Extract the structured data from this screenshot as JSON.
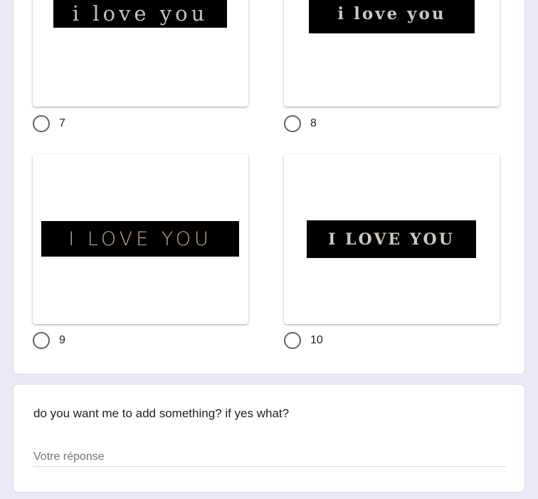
{
  "options": [
    {
      "label": "7",
      "image_text": "i love you",
      "image_style": "lowercase-serif"
    },
    {
      "label": "8",
      "image_text": "i love you",
      "image_style": "blackletter"
    },
    {
      "label": "9",
      "image_text": "I LOVE YOU",
      "image_style": "thin-sans-uppercase"
    },
    {
      "label": "10",
      "image_text": "I LOVE YOU",
      "image_style": "serif-uppercase"
    }
  ],
  "question": {
    "title": "do you want me to add something? if yes what?",
    "placeholder": "Votre réponse",
    "value": ""
  },
  "colors": {
    "page_background": "#ece8f7",
    "card_background": "#ffffff",
    "banner_background": "#000000",
    "radio_border": "#5f6368"
  }
}
